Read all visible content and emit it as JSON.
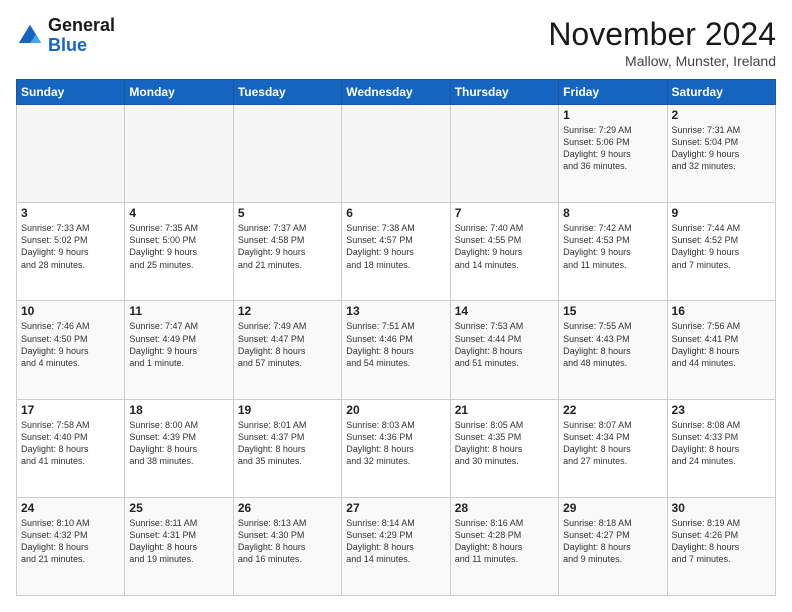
{
  "logo": {
    "line1": "General",
    "line2": "Blue"
  },
  "title": "November 2024",
  "location": "Mallow, Munster, Ireland",
  "days_header": [
    "Sunday",
    "Monday",
    "Tuesday",
    "Wednesday",
    "Thursday",
    "Friday",
    "Saturday"
  ],
  "weeks": [
    [
      {
        "day": "",
        "info": ""
      },
      {
        "day": "",
        "info": ""
      },
      {
        "day": "",
        "info": ""
      },
      {
        "day": "",
        "info": ""
      },
      {
        "day": "",
        "info": ""
      },
      {
        "day": "1",
        "info": "Sunrise: 7:29 AM\nSunset: 5:06 PM\nDaylight: 9 hours\nand 36 minutes."
      },
      {
        "day": "2",
        "info": "Sunrise: 7:31 AM\nSunset: 5:04 PM\nDaylight: 9 hours\nand 32 minutes."
      }
    ],
    [
      {
        "day": "3",
        "info": "Sunrise: 7:33 AM\nSunset: 5:02 PM\nDaylight: 9 hours\nand 28 minutes."
      },
      {
        "day": "4",
        "info": "Sunrise: 7:35 AM\nSunset: 5:00 PM\nDaylight: 9 hours\nand 25 minutes."
      },
      {
        "day": "5",
        "info": "Sunrise: 7:37 AM\nSunset: 4:58 PM\nDaylight: 9 hours\nand 21 minutes."
      },
      {
        "day": "6",
        "info": "Sunrise: 7:38 AM\nSunset: 4:57 PM\nDaylight: 9 hours\nand 18 minutes."
      },
      {
        "day": "7",
        "info": "Sunrise: 7:40 AM\nSunset: 4:55 PM\nDaylight: 9 hours\nand 14 minutes."
      },
      {
        "day": "8",
        "info": "Sunrise: 7:42 AM\nSunset: 4:53 PM\nDaylight: 9 hours\nand 11 minutes."
      },
      {
        "day": "9",
        "info": "Sunrise: 7:44 AM\nSunset: 4:52 PM\nDaylight: 9 hours\nand 7 minutes."
      }
    ],
    [
      {
        "day": "10",
        "info": "Sunrise: 7:46 AM\nSunset: 4:50 PM\nDaylight: 9 hours\nand 4 minutes."
      },
      {
        "day": "11",
        "info": "Sunrise: 7:47 AM\nSunset: 4:49 PM\nDaylight: 9 hours\nand 1 minute."
      },
      {
        "day": "12",
        "info": "Sunrise: 7:49 AM\nSunset: 4:47 PM\nDaylight: 8 hours\nand 57 minutes."
      },
      {
        "day": "13",
        "info": "Sunrise: 7:51 AM\nSunset: 4:46 PM\nDaylight: 8 hours\nand 54 minutes."
      },
      {
        "day": "14",
        "info": "Sunrise: 7:53 AM\nSunset: 4:44 PM\nDaylight: 8 hours\nand 51 minutes."
      },
      {
        "day": "15",
        "info": "Sunrise: 7:55 AM\nSunset: 4:43 PM\nDaylight: 8 hours\nand 48 minutes."
      },
      {
        "day": "16",
        "info": "Sunrise: 7:56 AM\nSunset: 4:41 PM\nDaylight: 8 hours\nand 44 minutes."
      }
    ],
    [
      {
        "day": "17",
        "info": "Sunrise: 7:58 AM\nSunset: 4:40 PM\nDaylight: 8 hours\nand 41 minutes."
      },
      {
        "day": "18",
        "info": "Sunrise: 8:00 AM\nSunset: 4:39 PM\nDaylight: 8 hours\nand 38 minutes."
      },
      {
        "day": "19",
        "info": "Sunrise: 8:01 AM\nSunset: 4:37 PM\nDaylight: 8 hours\nand 35 minutes."
      },
      {
        "day": "20",
        "info": "Sunrise: 8:03 AM\nSunset: 4:36 PM\nDaylight: 8 hours\nand 32 minutes."
      },
      {
        "day": "21",
        "info": "Sunrise: 8:05 AM\nSunset: 4:35 PM\nDaylight: 8 hours\nand 30 minutes."
      },
      {
        "day": "22",
        "info": "Sunrise: 8:07 AM\nSunset: 4:34 PM\nDaylight: 8 hours\nand 27 minutes."
      },
      {
        "day": "23",
        "info": "Sunrise: 8:08 AM\nSunset: 4:33 PM\nDaylight: 8 hours\nand 24 minutes."
      }
    ],
    [
      {
        "day": "24",
        "info": "Sunrise: 8:10 AM\nSunset: 4:32 PM\nDaylight: 8 hours\nand 21 minutes."
      },
      {
        "day": "25",
        "info": "Sunrise: 8:11 AM\nSunset: 4:31 PM\nDaylight: 8 hours\nand 19 minutes."
      },
      {
        "day": "26",
        "info": "Sunrise: 8:13 AM\nSunset: 4:30 PM\nDaylight: 8 hours\nand 16 minutes."
      },
      {
        "day": "27",
        "info": "Sunrise: 8:14 AM\nSunset: 4:29 PM\nDaylight: 8 hours\nand 14 minutes."
      },
      {
        "day": "28",
        "info": "Sunrise: 8:16 AM\nSunset: 4:28 PM\nDaylight: 8 hours\nand 11 minutes."
      },
      {
        "day": "29",
        "info": "Sunrise: 8:18 AM\nSunset: 4:27 PM\nDaylight: 8 hours\nand 9 minutes."
      },
      {
        "day": "30",
        "info": "Sunrise: 8:19 AM\nSunset: 4:26 PM\nDaylight: 8 hours\nand 7 minutes."
      }
    ]
  ]
}
